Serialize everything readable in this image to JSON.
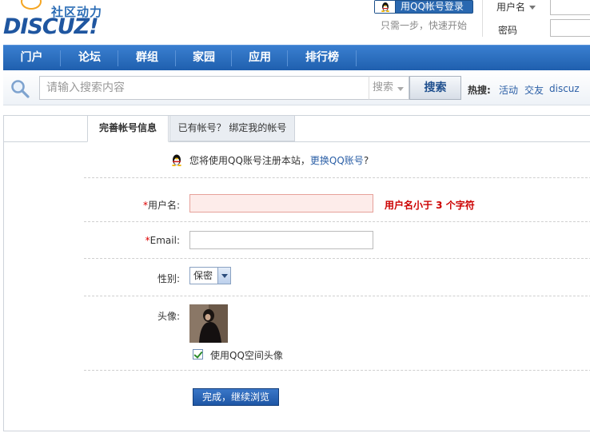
{
  "header": {
    "logo_subtitle": "社区动力",
    "logo_text": "DISCUZ!",
    "qq_login_label": "用QQ帐号登录",
    "qq_hint": "只需一步，快速开始",
    "login": {
      "username_label": "用户名",
      "password_label": "密码"
    }
  },
  "nav": {
    "items": [
      {
        "label": "门户"
      },
      {
        "label": "论坛"
      },
      {
        "label": "群组"
      },
      {
        "label": "家园"
      },
      {
        "label": "应用"
      },
      {
        "label": "排行榜"
      }
    ]
  },
  "search": {
    "placeholder": "请输入搜索内容",
    "type_label": "搜索",
    "button_label": "搜索",
    "hot_label": "热搜:",
    "hot_links": [
      "活动",
      "交友",
      "discuz"
    ]
  },
  "tabs": [
    {
      "label": "完善帐号信息",
      "active": true
    },
    {
      "label": "已有帐号？ 绑定我的帐号",
      "active": false
    }
  ],
  "notice": {
    "text": "您将使用QQ账号注册本站，",
    "link": "更换QQ账号",
    "suffix": "?"
  },
  "form": {
    "username": {
      "required_mark": "*",
      "label": "用户名:",
      "value": "",
      "error": "用户名小于 3 个字符"
    },
    "email": {
      "required_mark": "*",
      "label": "Email:",
      "value": ""
    },
    "gender": {
      "label": "性别:",
      "selected": "保密"
    },
    "avatar": {
      "label": "头像:",
      "use_qq_avatar_label": "使用QQ空间头像",
      "use_qq_avatar_checked": true
    },
    "submit_label": "完成，继续浏览"
  },
  "colors": {
    "nav_bg": "#1f5fae",
    "link": "#2b5fa6",
    "error": "#cc0000",
    "required": "#dd0000"
  }
}
